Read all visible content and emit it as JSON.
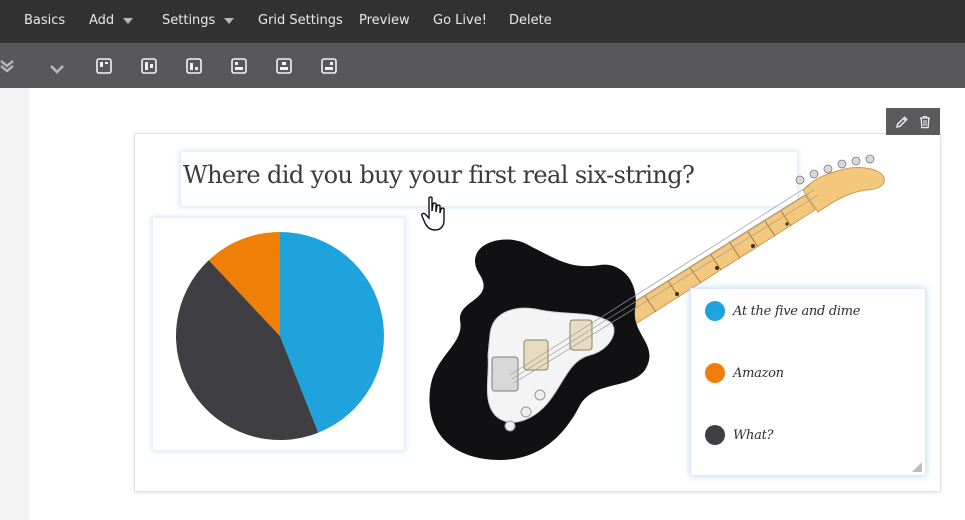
{
  "menu": {
    "items": [
      {
        "label": "Basics",
        "caret": false
      },
      {
        "label": "Add",
        "caret": true
      },
      {
        "label": "Settings",
        "caret": true
      },
      {
        "label": "Grid Settings",
        "caret": false
      },
      {
        "label": "Preview",
        "caret": false
      },
      {
        "label": "Go Live!",
        "caret": false
      },
      {
        "label": "Delete",
        "caret": false
      }
    ]
  },
  "toolbar": {
    "icons": [
      "collapse-all-icon",
      "chevron-down-icon",
      "align-top-left-icon",
      "align-middle-left-icon",
      "align-bottom-left-icon",
      "align-top-center-icon",
      "align-middle-center-icon",
      "align-bottom-center-icon"
    ]
  },
  "card": {
    "tools": [
      "pencil-icon",
      "trash-icon"
    ]
  },
  "question": {
    "text": "Where did you buy your first real six-string?"
  },
  "chart_data": {
    "type": "pie",
    "slices": [
      {
        "label": "At the five and dime",
        "value": 44,
        "color": "#1fa3dc"
      },
      {
        "label": "What?",
        "value": 44,
        "color": "#3e3e43"
      },
      {
        "label": "Amazon",
        "value": 12,
        "color": "#f07f07"
      }
    ]
  },
  "legend": {
    "items": [
      {
        "label": "At the five and dime",
        "color": "#1fa3dc"
      },
      {
        "label": "Amazon",
        "color": "#f07f07"
      },
      {
        "label": "What?",
        "color": "#3e3e43"
      }
    ]
  },
  "colors": {
    "menubar": "#323232",
    "toolbar": "#58585b",
    "accent_blue": "#1fa3dc",
    "accent_orange": "#f07f07",
    "dark_slice": "#3e3e43"
  },
  "image": {
    "name": "electric-guitar-image"
  }
}
